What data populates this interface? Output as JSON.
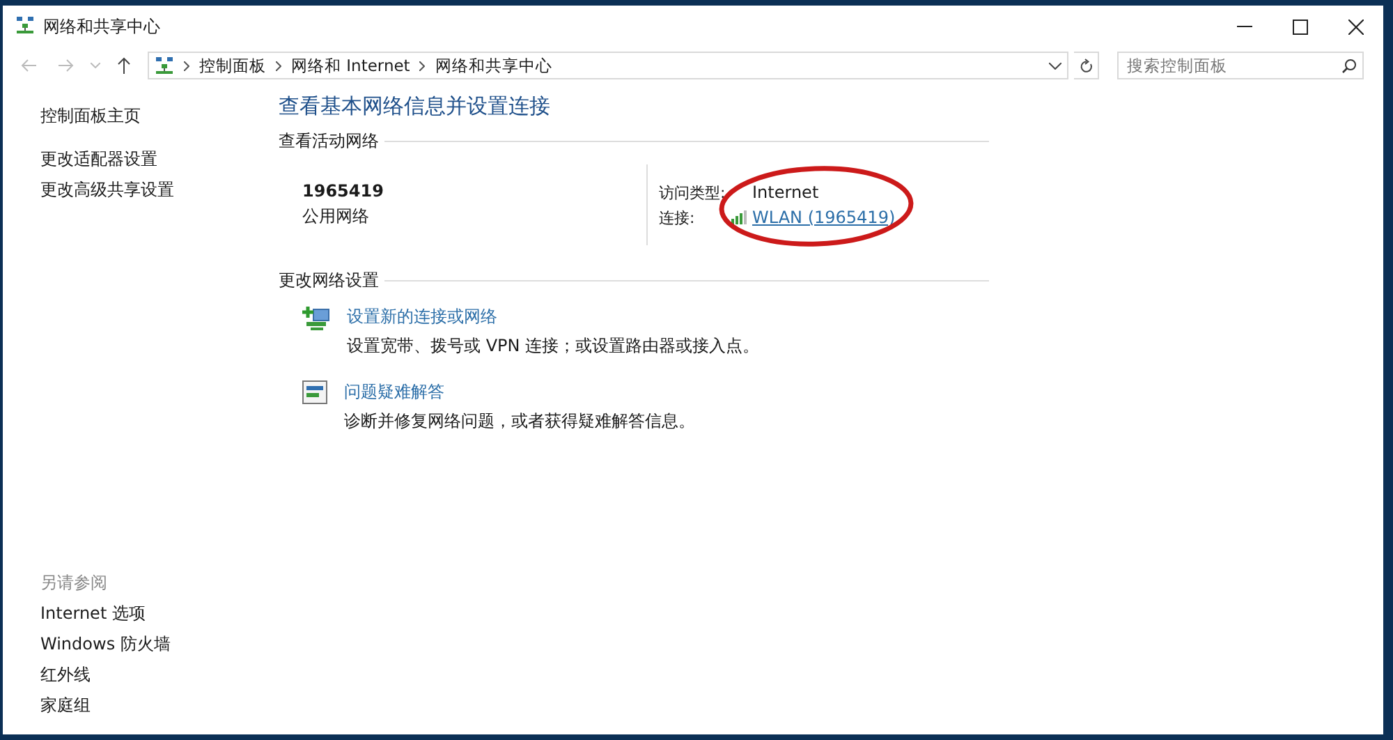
{
  "window": {
    "title": "网络和共享中心"
  },
  "address_bar": {
    "crumbs": [
      "控制面板",
      "网络和 Internet",
      "网络和共享中心"
    ]
  },
  "search": {
    "placeholder": "搜索控制面板"
  },
  "sidebar": {
    "items": [
      {
        "label": "控制面板主页"
      },
      {
        "label": "更改适配器设置"
      },
      {
        "label": "更改高级共享设置"
      }
    ],
    "see_also": {
      "title": "另请参阅",
      "items": [
        {
          "label": "Internet 选项"
        },
        {
          "label": "Windows 防火墙"
        },
        {
          "label": "红外线"
        },
        {
          "label": "家庭组"
        }
      ]
    }
  },
  "heading": "查看基本网络信息并设置连接",
  "active_networks": {
    "title": "查看活动网络",
    "name": "1965419",
    "category": "公用网络",
    "fields": [
      {
        "label": "访问类型:",
        "kind": "text",
        "value": "Internet"
      },
      {
        "label": "连接:",
        "kind": "link",
        "value": "WLAN (1965419)"
      }
    ]
  },
  "change_settings": {
    "title": "更改网络设置",
    "tasks": [
      {
        "kind": "new-connection",
        "title": "设置新的连接或网络",
        "description": "设置宽带、拨号或 VPN 连接；或设置路由器或接入点。"
      },
      {
        "kind": "troubleshoot",
        "title": "问题疑难解答",
        "description": "诊断并修复网络问题，或者获得疑难解答信息。"
      }
    ]
  },
  "annotation": {
    "kind": "ellipse"
  }
}
